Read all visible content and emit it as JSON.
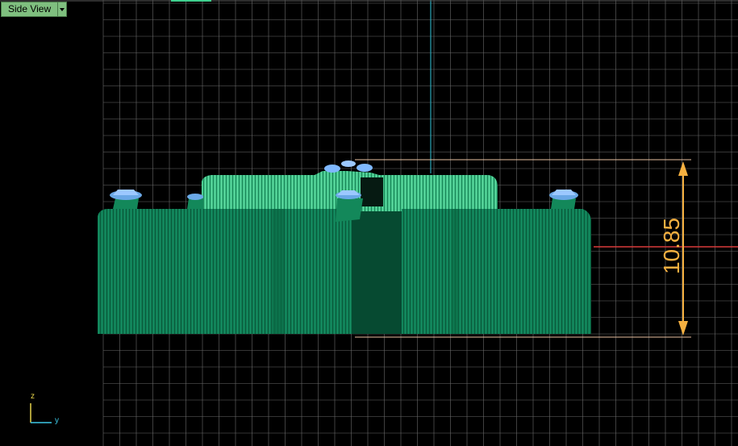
{
  "view": {
    "name": "Side View",
    "dropdown_icon": "chevron-down-icon"
  },
  "dimension": {
    "value": "10.85",
    "color": "#f5b040"
  },
  "axes": {
    "vertical_label": "z",
    "horizontal_label": "y",
    "vertical_color": "#e6d34a",
    "horizontal_color": "#3cc8e6"
  },
  "colors": {
    "background": "#000000",
    "grid": "#6a6a6a",
    "model_dark": "#0d7a50",
    "model_light": "#3fcf8e",
    "gem": "#7fb8ff",
    "reference_line": "#d83a3a",
    "vertical_axis_line": "#2aa6b8"
  }
}
